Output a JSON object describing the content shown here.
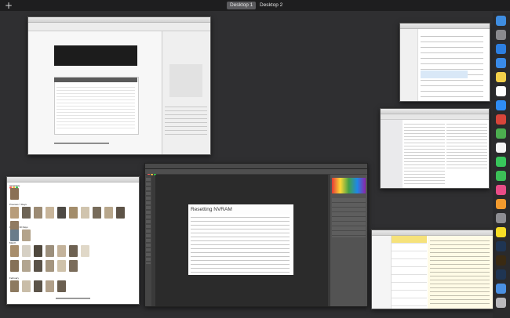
{
  "spaces": {
    "tabs": [
      {
        "label": "Desktop 1",
        "active": true
      },
      {
        "label": "Desktop 2",
        "active": false
      }
    ]
  },
  "photoshop_window": {
    "heading": "Resetting NVRAM"
  },
  "finder_window": {
    "section_labels": [
      "Yesterday",
      "Previous 7 Days",
      "Previous 30 Days",
      "March",
      "February"
    ]
  },
  "dock": {
    "icons": [
      "finder-icon",
      "launchpad-icon",
      "safari-icon",
      "mail-icon",
      "notes-icon",
      "calendar-icon",
      "app-store-icon",
      "chrome-icon",
      "maps-icon",
      "photos-icon",
      "messages-icon",
      "facetime-icon",
      "itunes-icon",
      "ibooks-icon",
      "system-preferences-icon",
      "kakaotalk-icon",
      "photoshop-icon",
      "illustrator-icon",
      "photoshop-cc-icon",
      "downloads-icon",
      "trash-icon"
    ],
    "colors": [
      "#3f8de0",
      "#8a8a8e",
      "#2d7fe0",
      "#3a8be8",
      "#f3d04a",
      "#ffffff",
      "#2f8df5",
      "#d8453a",
      "#4cae4f",
      "#f4f4f4",
      "#38c65b",
      "#3cc057",
      "#e84c87",
      "#f29a2e",
      "#8d8d92",
      "#f7dd26",
      "#1f3553",
      "#3a2a12",
      "#1f3553",
      "#4a90e2",
      "#b9b9bd"
    ]
  }
}
